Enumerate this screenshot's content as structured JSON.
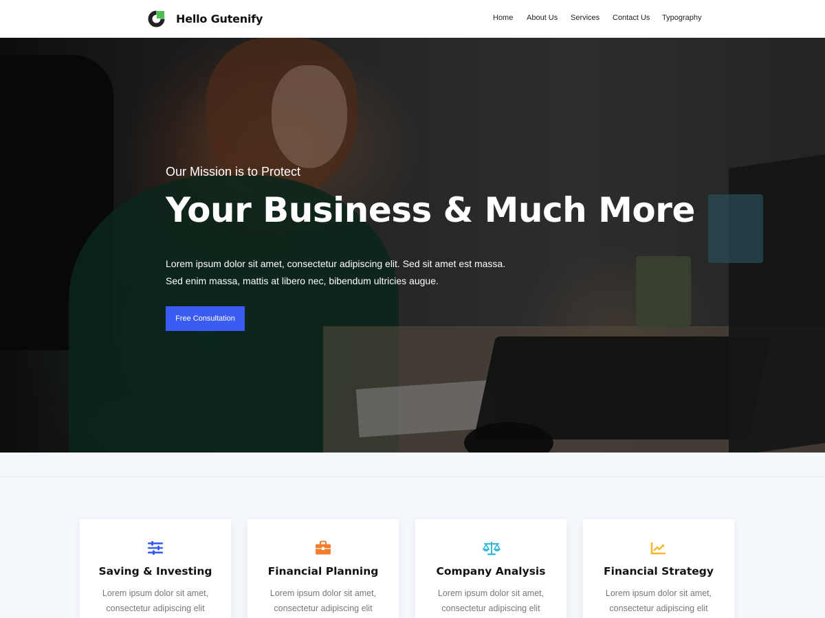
{
  "site": {
    "name": "Hello Gutenify",
    "logo_icon": "logo-icon"
  },
  "nav": {
    "items": [
      {
        "label": "Home"
      },
      {
        "label": "About Us"
      },
      {
        "label": "Services"
      },
      {
        "label": "Contact Us"
      },
      {
        "label": "Typography"
      }
    ]
  },
  "hero": {
    "kicker": "Our Mission is to Protect",
    "title": "Your Business & Much More",
    "description_line1": "Lorem ipsum dolor sit amet, consectetur adipiscing elit. Sed sit amet est massa.",
    "description_line2": "Sed enim massa, mattis at libero nec, bibendum ultricies augue.",
    "cta_label": "Free Consultation",
    "cta_color": "#3a5cf2"
  },
  "services": {
    "cards": [
      {
        "icon": "sliders-icon",
        "icon_color": "#3a5cf2",
        "title": "Saving & Investing",
        "text_line1": "Lorem ipsum dolor sit amet,",
        "text_line2": "consectetur adipiscing elit"
      },
      {
        "icon": "briefcase-icon",
        "icon_color": "#f47c2c",
        "title": "Financial Planning",
        "text_line1": "Lorem ipsum dolor sit amet,",
        "text_line2": "consectetur adipiscing elit"
      },
      {
        "icon": "scale-icon",
        "icon_color": "#2fb8dc",
        "title": "Company Analysis",
        "text_line1": "Lorem ipsum dolor sit amet,",
        "text_line2": "consectetur adipiscing elit"
      },
      {
        "icon": "chart-line-icon",
        "icon_color": "#f5b82e",
        "title": "Financial Strategy",
        "text_line1": "Lorem ipsum dolor sit amet,",
        "text_line2": "consectetur adipiscing elit"
      }
    ]
  }
}
